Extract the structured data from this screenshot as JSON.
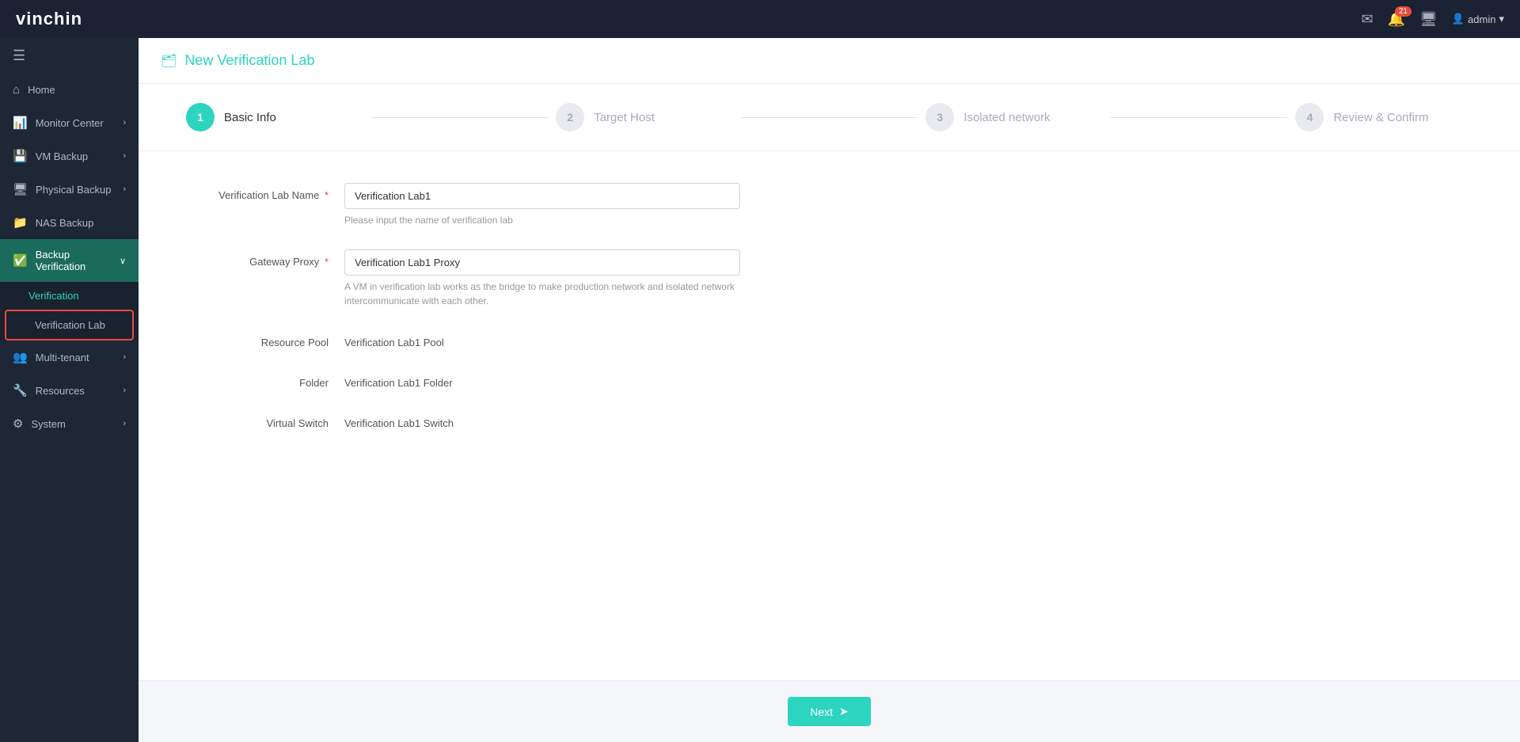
{
  "app": {
    "logo_text": "vinchin"
  },
  "topnav": {
    "notification_count": "21",
    "user_label": "admin",
    "chevron": "▾"
  },
  "sidebar": {
    "menu_icon": "☰",
    "items": [
      {
        "id": "home",
        "label": "Home",
        "icon": "⌂",
        "has_children": false
      },
      {
        "id": "monitor-center",
        "label": "Monitor Center",
        "icon": "📊",
        "has_children": true
      },
      {
        "id": "vm-backup",
        "label": "VM Backup",
        "icon": "💾",
        "has_children": true
      },
      {
        "id": "physical-backup",
        "label": "Physical Backup",
        "icon": "🖥",
        "has_children": true
      },
      {
        "id": "nas-backup",
        "label": "NAS Backup",
        "icon": "📁",
        "has_children": false
      },
      {
        "id": "backup-verification",
        "label": "Backup Verification",
        "icon": "✅",
        "has_children": true,
        "active": true
      },
      {
        "id": "multi-tenant",
        "label": "Multi-tenant",
        "icon": "👥",
        "has_children": true
      },
      {
        "id": "resources",
        "label": "Resources",
        "icon": "🔧",
        "has_children": true
      },
      {
        "id": "system",
        "label": "System",
        "icon": "⚙",
        "has_children": true
      }
    ],
    "backup_verification_children": [
      {
        "id": "verification",
        "label": "Verification"
      },
      {
        "id": "verification-lab",
        "label": "Verification Lab",
        "highlighted": true
      }
    ]
  },
  "page": {
    "header_icon": "🗂",
    "title": "New Verification Lab"
  },
  "wizard": {
    "steps": [
      {
        "number": "1",
        "label": "Basic Info",
        "active": true
      },
      {
        "number": "2",
        "label": "Target Host",
        "active": false
      },
      {
        "number": "3",
        "label": "Isolated network",
        "active": false
      },
      {
        "number": "4",
        "label": "Review & Confirm",
        "active": false
      }
    ]
  },
  "form": {
    "fields": [
      {
        "id": "verification-lab-name",
        "label": "Verification Lab Name",
        "required": true,
        "type": "input",
        "value": "Verification Lab1",
        "hint": "Please input the name of verification lab"
      },
      {
        "id": "gateway-proxy",
        "label": "Gateway Proxy",
        "required": true,
        "type": "input",
        "value": "Verification Lab1 Proxy",
        "hint": "A VM in verification lab works as the bridge to make production network and isolated network intercommunicate with each other."
      },
      {
        "id": "resource-pool",
        "label": "Resource Pool",
        "required": false,
        "type": "text",
        "value": "Verification Lab1 Pool"
      },
      {
        "id": "folder",
        "label": "Folder",
        "required": false,
        "type": "text",
        "value": "Verification Lab1 Folder"
      },
      {
        "id": "virtual-switch",
        "label": "Virtual Switch",
        "required": false,
        "type": "text",
        "value": "Verification Lab1 Switch"
      }
    ]
  },
  "footer": {
    "next_label": "Next",
    "next_icon": "→"
  }
}
